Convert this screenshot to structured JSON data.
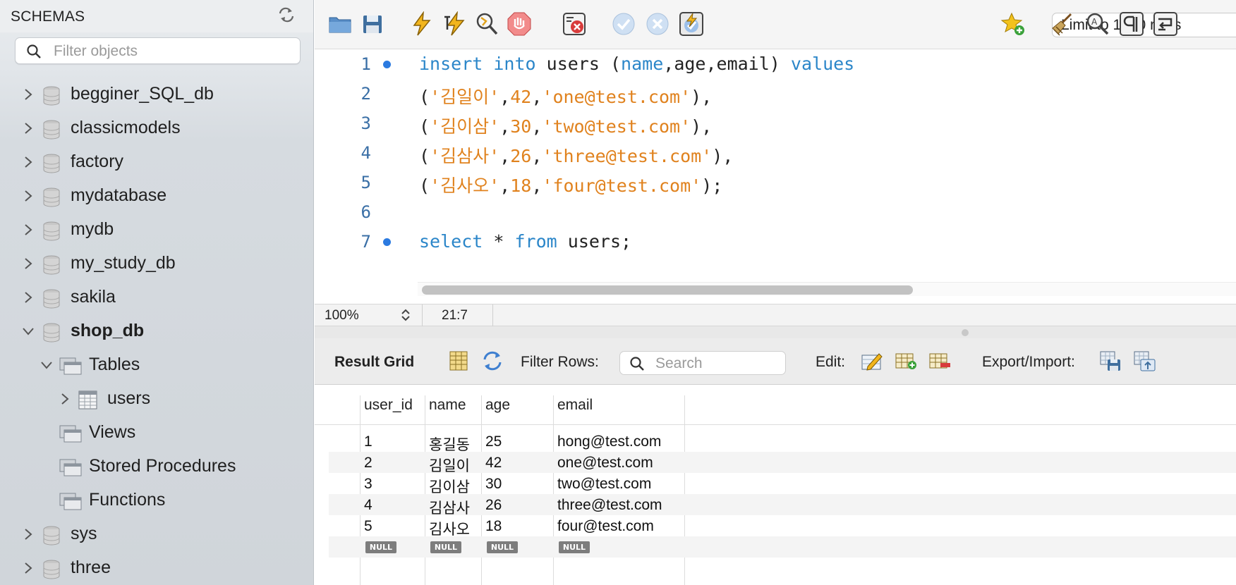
{
  "sidebar": {
    "title": "SCHEMAS",
    "filter_placeholder": "Filter objects",
    "databases": [
      {
        "label": "begginer_SQL_db"
      },
      {
        "label": "classicmodels"
      },
      {
        "label": "factory"
      },
      {
        "label": "mydatabase"
      },
      {
        "label": "mydb"
      },
      {
        "label": "my_study_db"
      },
      {
        "label": "sakila"
      },
      {
        "label": "shop_db"
      },
      {
        "label": "sys"
      },
      {
        "label": "three"
      }
    ],
    "shop_db_children": {
      "tables": "Tables",
      "users": "users",
      "views": "Views",
      "procedures": "Stored Procedures",
      "functions": "Functions"
    }
  },
  "toolbar": {
    "limit_selected": "Limit to 1000 rows",
    "icons": [
      "open-folder-icon",
      "save-icon",
      "execute-icon",
      "execute-current-icon",
      "explain-icon",
      "stop-icon",
      "toggle-stop-on-error-icon",
      "commit-icon",
      "rollback-icon",
      "autocommit-icon",
      "add-snippet-icon",
      "beautify-icon",
      "find-icon",
      "invisibles-icon",
      "wrap-icon"
    ]
  },
  "editor": {
    "lines": [
      {
        "n": "1",
        "marker": true
      },
      {
        "n": "2",
        "marker": false
      },
      {
        "n": "3",
        "marker": false
      },
      {
        "n": "4",
        "marker": false
      },
      {
        "n": "5",
        "marker": false
      },
      {
        "n": "6",
        "marker": false
      },
      {
        "n": "7",
        "marker": true
      }
    ],
    "code": {
      "l1_kw1": "insert",
      "l1_kw2": "into",
      "l1_tbl": "users",
      "l1_open": "(",
      "l1_c1": "name",
      "l1_c2": "age,email",
      "l1_close": ")",
      "l1_kw3": "values",
      "rows": [
        {
          "name": "'김일이'",
          "age": "42",
          "email": "'one@test.com'",
          "end": "),"
        },
        {
          "name": "'김이삼'",
          "age": "30",
          "email": "'two@test.com'",
          "end": "),"
        },
        {
          "name": "'김삼사'",
          "age": "26",
          "email": "'three@test.com'",
          "end": "),"
        },
        {
          "name": "'김사오'",
          "age": "18",
          "email": "'four@test.com'",
          "end": ");"
        }
      ],
      "l7_kw1": "select",
      "l7_star": "*",
      "l7_kw2": "from",
      "l7_rest": "users;"
    }
  },
  "status": {
    "zoom": "100%",
    "cursor": "21:7"
  },
  "result": {
    "title": "Result Grid",
    "filter_label": "Filter Rows:",
    "search_placeholder": "Search",
    "edit_label": "Edit:",
    "export_label": "Export/Import:",
    "columns": [
      "user_id",
      "name",
      "age",
      "email"
    ],
    "rows": [
      [
        "1",
        "홍길동",
        "25",
        "hong@test.com"
      ],
      [
        "2",
        "김일이",
        "42",
        "one@test.com"
      ],
      [
        "3",
        "김이삼",
        "30",
        "two@test.com"
      ],
      [
        "4",
        "김삼사",
        "26",
        "three@test.com"
      ],
      [
        "5",
        "김사오",
        "18",
        "four@test.com"
      ]
    ],
    "null_label": "NULL"
  },
  "colors": {
    "keyword": "#2b86c9",
    "string": "#e0821e",
    "line_number": "#3a6fa6",
    "marker": "#2b7ae0",
    "accent": "#2f7df6"
  }
}
